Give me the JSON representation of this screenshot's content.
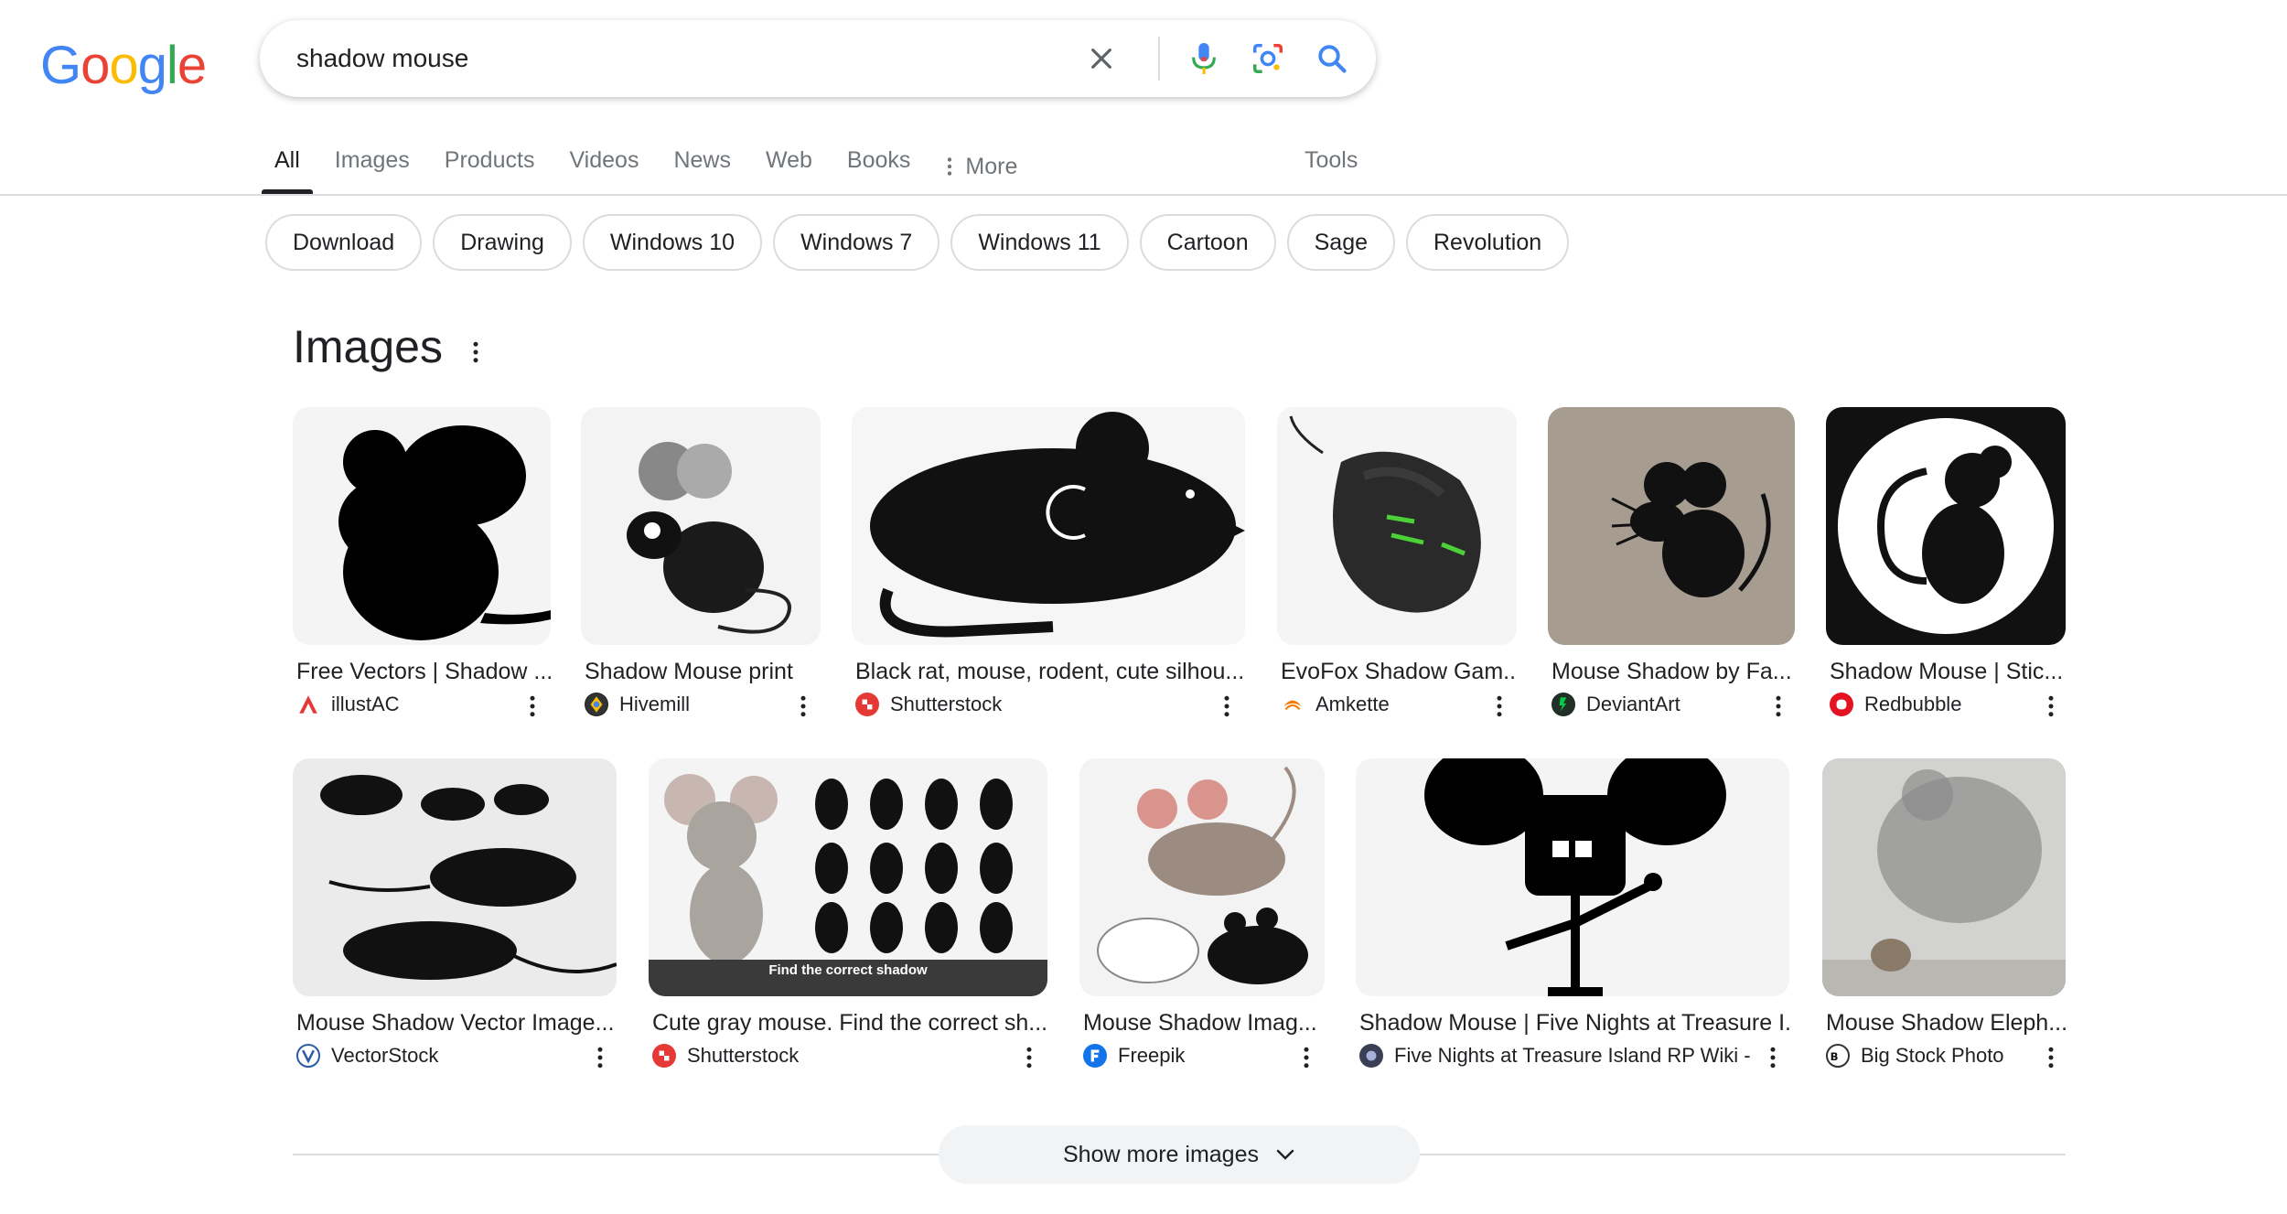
{
  "logo": {
    "letters": [
      "G",
      "o",
      "o",
      "g",
      "l",
      "e"
    ],
    "colors": [
      "#4285F4",
      "#EA4335",
      "#FBBC05",
      "#4285F4",
      "#34A853",
      "#EA4335"
    ]
  },
  "search": {
    "query": "shadow mouse"
  },
  "tabs": [
    "All",
    "Images",
    "Products",
    "Videos",
    "News",
    "Web",
    "Books"
  ],
  "tabs_more": "More",
  "tools": "Tools",
  "chips": [
    "Download",
    "Drawing",
    "Windows 10",
    "Windows 7",
    "Windows 11",
    "Cartoon",
    "Sage",
    "Revolution"
  ],
  "images_heading": "Images",
  "results": [
    {
      "title": "Free Vectors | Shadow ...",
      "source": "illustAC"
    },
    {
      "title": "Shadow Mouse print",
      "source": "Hivemill"
    },
    {
      "title": "Black rat, mouse, rodent, cute silhou...",
      "source": "Shutterstock"
    },
    {
      "title": "EvoFox Shadow Gam...",
      "source": "Amkette"
    },
    {
      "title": "Mouse Shadow by Fa...",
      "source": "DeviantArt"
    },
    {
      "title": "Shadow Mouse | Stic...",
      "source": "Redbubble"
    },
    {
      "title": "Mouse Shadow Vector Image...",
      "source": "VectorStock"
    },
    {
      "title": "Cute gray mouse. Find the correct sh...",
      "source": "Shutterstock",
      "caption": "Find the correct shadow"
    },
    {
      "title": "Mouse Shadow Imag...",
      "source": "Freepik"
    },
    {
      "title": "Shadow Mouse | Five Nights at Treasure I...",
      "source": "Five Nights at Treasure Island RP Wiki -..."
    },
    {
      "title": "Mouse Shadow Eleph...",
      "source": "Big Stock Photo"
    }
  ],
  "show_more": "Show more images",
  "colors": {
    "accent_blue": "#4285F4",
    "text": "#202124",
    "muted": "#70757a",
    "border": "#dadce0"
  }
}
